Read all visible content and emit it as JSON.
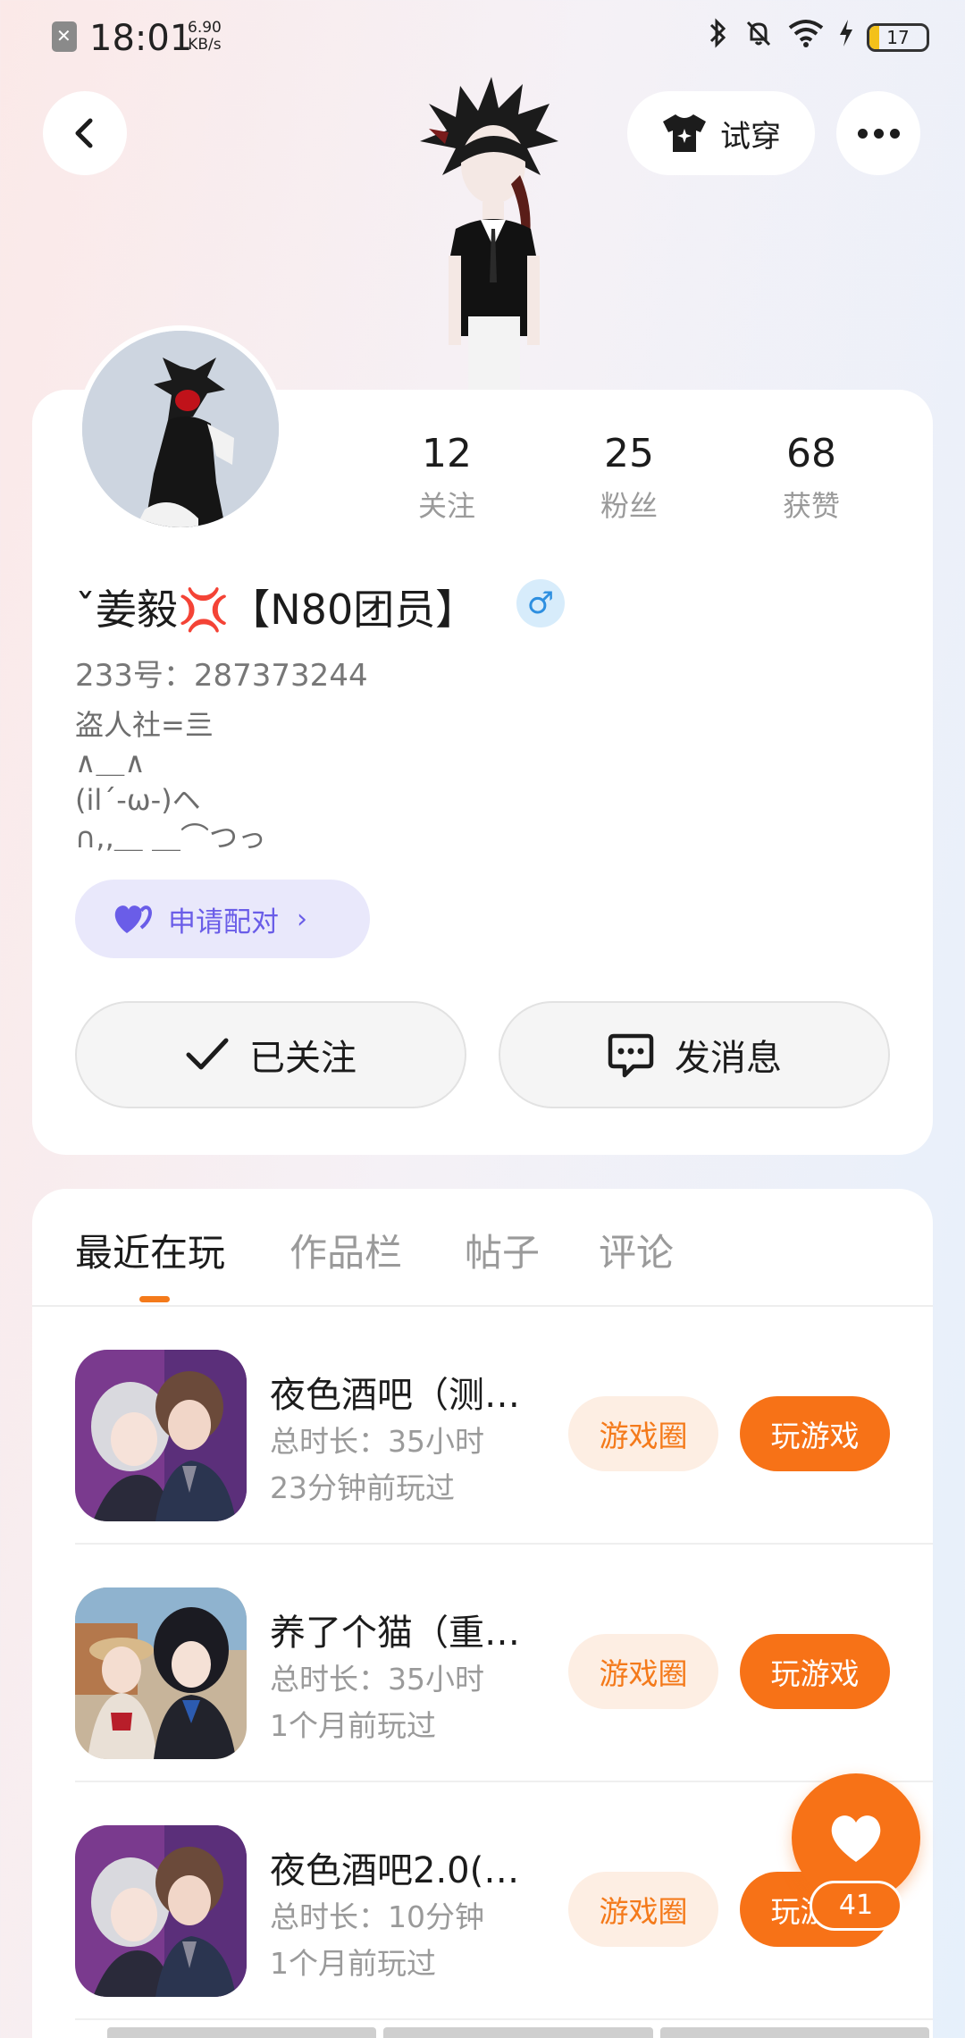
{
  "status_bar": {
    "time": "18:01",
    "speed_value": "6.90",
    "speed_unit": "KB/s",
    "battery": "17",
    "battery_level_percent": 17,
    "icons": [
      "bluetooth-icon",
      "mute-icon",
      "wifi-icon",
      "charging-icon"
    ]
  },
  "header": {
    "tryon_label": "试穿"
  },
  "profile": {
    "stats": [
      {
        "value": "12",
        "label": "关注"
      },
      {
        "value": "25",
        "label": "粉丝"
      },
      {
        "value": "68",
        "label": "获赞"
      }
    ],
    "nickname": "ˇ姜毅💢【N80团员】",
    "gender_symbol": "♂",
    "id_text": "233号：287373244",
    "bio_lines": [
      "盗人社=亖",
      "∧＿∧",
      "(il´‐ω‐)ヘ",
      "∩,,＿ ＿⌒つっ"
    ],
    "pair_label": "申请配对",
    "follow_label": "已关注",
    "message_label": "发消息"
  },
  "tabs": [
    {
      "label": "最近在玩",
      "active": true
    },
    {
      "label": "作品栏",
      "active": false
    },
    {
      "label": "帖子",
      "active": false
    },
    {
      "label": "评论",
      "active": false
    }
  ],
  "games": [
    {
      "title": "夜色酒吧（测…",
      "duration": "总时长：35小时",
      "last_played": "23分钟前玩过",
      "circle_label": "游戏圈",
      "play_label": "玩游戏"
    },
    {
      "title": "养了个猫（重…",
      "duration": "总时长：35小时",
      "last_played": "1个月前玩过",
      "circle_label": "游戏圈",
      "play_label": "玩游戏"
    },
    {
      "title": "夜色酒吧2.0(…",
      "duration": "总时长：10分钟",
      "last_played": "1个月前玩过",
      "circle_label": "游戏圈",
      "play_label": "玩游戏"
    }
  ],
  "like_fab": {
    "count": "41"
  },
  "colors": {
    "accent": "#f77217",
    "accent_soft": "#fdeee3",
    "pair_purple": "#6a5de8",
    "pair_bg": "#e9e8fb",
    "male_blue": "#2e8fe0"
  }
}
